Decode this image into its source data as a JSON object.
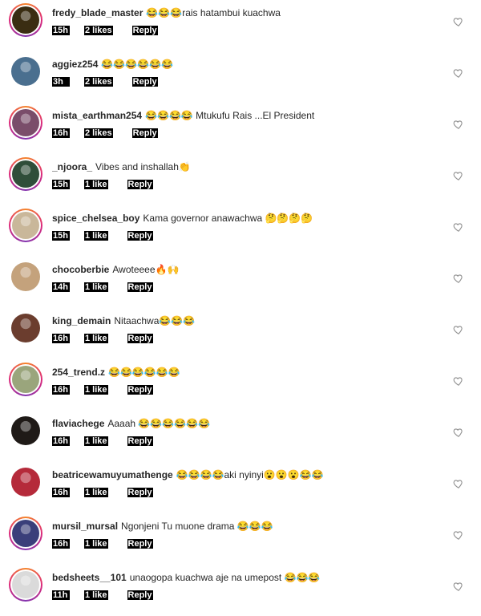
{
  "comments": [
    {
      "username": "fredy_blade_master",
      "text": "😂😂😂rais hatambui kuachwa",
      "time": "15h",
      "likes": "2 likes",
      "reply": "Reply",
      "avatar_color": "#3a2d12",
      "story": true
    },
    {
      "username": "aggiez254",
      "text": "😂😂😂😂😂😂",
      "time": "3h",
      "likes": "2 likes",
      "reply": "Reply",
      "avatar_color": "#4a6f8f",
      "story": false
    },
    {
      "username": "mista_earthman254",
      "text": "😂😂😂😂 Mtukufu Rais ...El President",
      "time": "16h",
      "likes": "2 likes",
      "reply": "Reply",
      "avatar_color": "#7a4d6a",
      "story": true
    },
    {
      "username": "_njoora_",
      "text": "Vibes and inshallah👏",
      "time": "15h",
      "likes": "1 like",
      "reply": "Reply",
      "avatar_color": "#2f4e3a",
      "story": true
    },
    {
      "username": "spice_chelsea_boy",
      "text": "Kama governor anawachwa 🤔🤔🤔🤔",
      "time": "15h",
      "likes": "1 like",
      "reply": "Reply",
      "avatar_color": "#c9b79a",
      "story": true
    },
    {
      "username": "chocoberbie",
      "text": "Awoteeee🔥🙌",
      "time": "14h",
      "likes": "1 like",
      "reply": "Reply",
      "avatar_color": "#c4a27c",
      "story": false
    },
    {
      "username": "king_demain",
      "text": "Nitaachwa😂😂😂",
      "time": "16h",
      "likes": "1 like",
      "reply": "Reply",
      "avatar_color": "#6b3d2e",
      "story": false
    },
    {
      "username": "254_trend.z",
      "text": "😂😂😂😂😂😂",
      "time": "16h",
      "likes": "1 like",
      "reply": "Reply",
      "avatar_color": "#9aa57c",
      "story": true
    },
    {
      "username": "flaviachege",
      "text": "Aaaah 😂😂😂😂😂😂",
      "time": "16h",
      "likes": "1 like",
      "reply": "Reply",
      "avatar_color": "#1f1a17",
      "story": false
    },
    {
      "username": "beatricewamuyumathenge",
      "text": "😂😂😂😂aki nyinyi😮😮😮😂😂",
      "time": "16h",
      "likes": "1 like",
      "reply": "Reply",
      "avatar_color": "#b52a3a",
      "story": false
    },
    {
      "username": "mursil_mursal",
      "text": "Ngonjeni Tu muone drama 😂😂😂",
      "time": "16h",
      "likes": "1 like",
      "reply": "Reply",
      "avatar_color": "#3a3f7a",
      "story": true
    },
    {
      "username": "bedsheets__101",
      "text": "unaogopa kuachwa aje na umepost 😂😂😂",
      "time": "11h",
      "likes": "1 like",
      "reply": "Reply",
      "avatar_color": "#dadada",
      "story": true
    }
  ],
  "icons": {
    "like": "heart-outline-icon"
  }
}
